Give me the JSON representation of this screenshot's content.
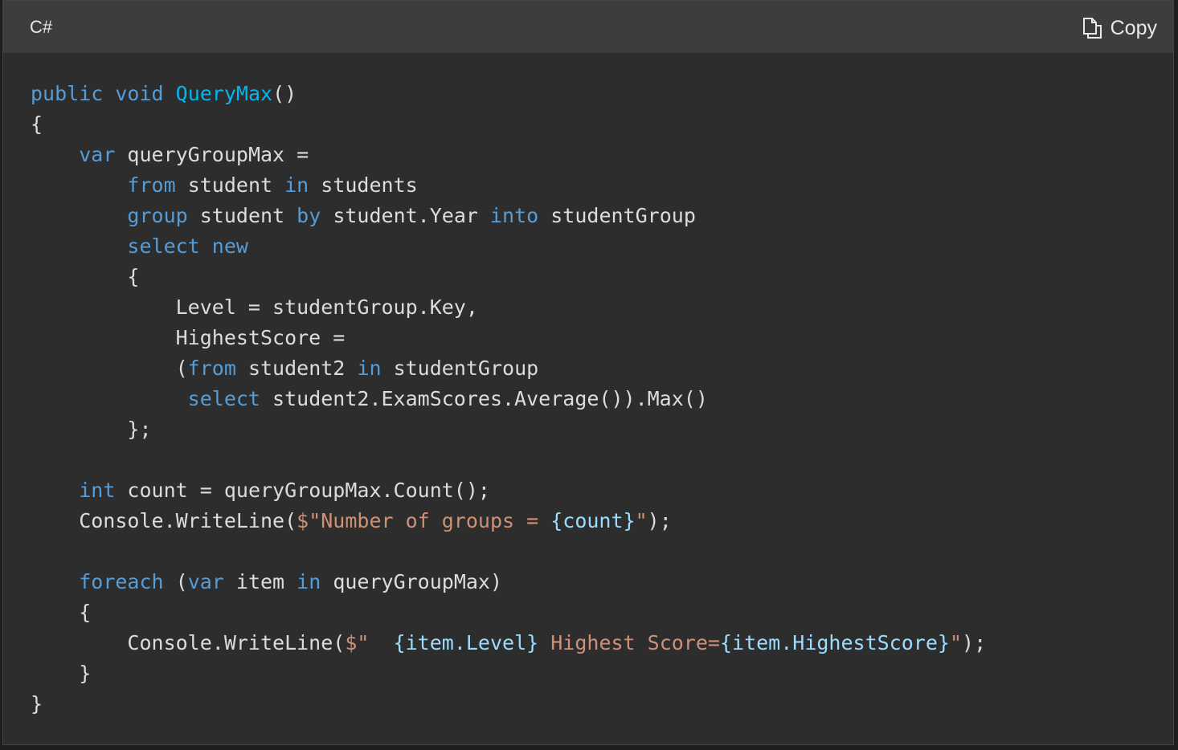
{
  "header": {
    "language_label": "C#",
    "copy_label": "Copy",
    "copy_icon": "copy-icon"
  },
  "colors": {
    "keyword": "#569cd6",
    "method": "#00b7f0",
    "string": "#ce9178",
    "interpolation": "#9cdcfe",
    "text": "#dcdcdc",
    "background": "#2d2d2d",
    "header_background": "#3d3d3d"
  },
  "code": {
    "lines": [
      [
        {
          "t": "public",
          "c": "kw"
        },
        {
          "t": " "
        },
        {
          "t": "void",
          "c": "kw"
        },
        {
          "t": " "
        },
        {
          "t": "QueryMax",
          "c": "fn"
        },
        {
          "t": "()"
        }
      ],
      [
        {
          "t": "{"
        }
      ],
      [
        {
          "t": "    "
        },
        {
          "t": "var",
          "c": "kw"
        },
        {
          "t": " queryGroupMax ="
        }
      ],
      [
        {
          "t": "        "
        },
        {
          "t": "from",
          "c": "kw"
        },
        {
          "t": " student "
        },
        {
          "t": "in",
          "c": "kw"
        },
        {
          "t": " students"
        }
      ],
      [
        {
          "t": "        "
        },
        {
          "t": "group",
          "c": "kw"
        },
        {
          "t": " student "
        },
        {
          "t": "by",
          "c": "kw"
        },
        {
          "t": " student.Year "
        },
        {
          "t": "into",
          "c": "kw"
        },
        {
          "t": " studentGroup"
        }
      ],
      [
        {
          "t": "        "
        },
        {
          "t": "select",
          "c": "kw"
        },
        {
          "t": " "
        },
        {
          "t": "new",
          "c": "kw"
        }
      ],
      [
        {
          "t": "        {"
        }
      ],
      [
        {
          "t": "            Level = studentGroup.Key,"
        }
      ],
      [
        {
          "t": "            HighestScore ="
        }
      ],
      [
        {
          "t": "            ("
        },
        {
          "t": "from",
          "c": "kw"
        },
        {
          "t": " student2 "
        },
        {
          "t": "in",
          "c": "kw"
        },
        {
          "t": " studentGroup"
        }
      ],
      [
        {
          "t": "             "
        },
        {
          "t": "select",
          "c": "kw"
        },
        {
          "t": " student2.ExamScores.Average()).Max()"
        }
      ],
      [
        {
          "t": "        };"
        }
      ],
      [
        {
          "t": ""
        }
      ],
      [
        {
          "t": "    "
        },
        {
          "t": "int",
          "c": "kw"
        },
        {
          "t": " count = queryGroupMax.Count();"
        }
      ],
      [
        {
          "t": "    Console.WriteLine("
        },
        {
          "t": "$\"Number of groups = ",
          "c": "str"
        },
        {
          "t": "{count}",
          "c": "interp"
        },
        {
          "t": "\"",
          "c": "str"
        },
        {
          "t": ");"
        }
      ],
      [
        {
          "t": ""
        }
      ],
      [
        {
          "t": "    "
        },
        {
          "t": "foreach",
          "c": "kw"
        },
        {
          "t": " ("
        },
        {
          "t": "var",
          "c": "kw"
        },
        {
          "t": " item "
        },
        {
          "t": "in",
          "c": "kw"
        },
        {
          "t": " queryGroupMax)"
        }
      ],
      [
        {
          "t": "    {"
        }
      ],
      [
        {
          "t": "        Console.WriteLine("
        },
        {
          "t": "$\"  ",
          "c": "str"
        },
        {
          "t": "{item.Level}",
          "c": "interp"
        },
        {
          "t": " Highest Score=",
          "c": "str"
        },
        {
          "t": "{item.HighestScore}",
          "c": "interp"
        },
        {
          "t": "\"",
          "c": "str"
        },
        {
          "t": ");"
        }
      ],
      [
        {
          "t": "    }"
        }
      ],
      [
        {
          "t": "}"
        }
      ]
    ]
  }
}
